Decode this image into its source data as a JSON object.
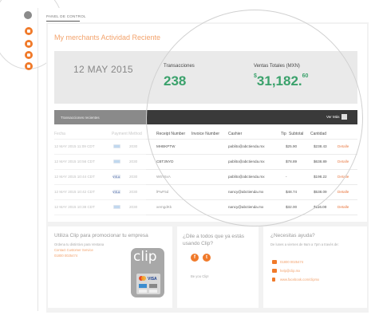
{
  "tab": {
    "label": "PANEL DE CONTROL"
  },
  "header": {
    "title": "My merchants Actividad Reciente"
  },
  "stats": {
    "date": "12 MAY 2015",
    "transactions_label": "Transacciones",
    "transactions_value": "238",
    "sales_label": "Ventas Totales (MXN)",
    "sales_dollar": "$",
    "sales_int": "31,182.",
    "sales_cents": "60"
  },
  "table": {
    "title": "Transacciones recientes",
    "more": "Ver Más",
    "headers": [
      "Fecha",
      "Payment Method",
      "Receipt Number",
      "Invoice Number",
      "Cashier",
      "Tip",
      "Subtotal",
      "Cantidad"
    ],
    "rows": [
      {
        "date": "12 MAY 2015 11:09 CDT",
        "brand": "amex",
        "last4": "2030",
        "receipt": "MHBKPTW",
        "cashier": "pablito@abctienda.mx",
        "tip": "",
        "subtotal": "$25.90",
        "amount": "$238.43",
        "action": "Detalle"
      },
      {
        "date": "12 MAY 2015 10:56 CDT",
        "brand": "amex",
        "last4": "2030",
        "receipt": "CBT3NYD",
        "cashier": "pablito@abctienda.mx",
        "tip": "",
        "subtotal": "$78.89",
        "amount": "$638.89",
        "action": "Detalle"
      },
      {
        "date": "12 MAY 2015 10:44 CDT",
        "brand": "visa",
        "last4": "2030",
        "receipt": "W6Y6xA",
        "cashier": "pablito@abctienda.mx",
        "tip": "",
        "subtotal": "-",
        "amount": "$198.22",
        "action": "Detalle"
      },
      {
        "date": "12 MAY 2015 10:42 CDT",
        "brand": "visa",
        "last4": "2030",
        "receipt": "lPwF5d",
        "cashier": "nancy@abctienda.mx",
        "tip": "",
        "subtotal": "$48.74",
        "amount": "$538.09",
        "action": "Detalle"
      },
      {
        "date": "12 MAY 2015 10:38 CDT",
        "brand": "amex",
        "last4": "2030",
        "receipt": "xemgdKk",
        "cashier": "nancy@abctienda.mx",
        "tip": "",
        "subtotal": "$32.00",
        "amount": "$116.00",
        "action": "Detalle"
      }
    ]
  },
  "promo": {
    "title": "Utiliza Clip para promocionar tu empresa",
    "subtitle": "Ordena tu distintivo para Ventana",
    "link": "Contact Customer Service",
    "phone": "01800 0025474",
    "brand": "clip",
    "cards": "VISA"
  },
  "social": {
    "title": "¿Dile a todos que ya estás usando Clip?",
    "fb": "f",
    "tw": "t",
    "footer": "Be you Clip!"
  },
  "help": {
    "title": "¿Necesitas ayuda?",
    "hours": "De lunes a viernes de 9am a 7pm a través de:",
    "phone": "01800 0025474",
    "email": "help@clip.mx",
    "facebook": "www.facebook.com/clipmx"
  },
  "colors": {
    "accent": "#f07a2a",
    "positive": "#2a9a5f",
    "dark": "#2a2a2a"
  }
}
